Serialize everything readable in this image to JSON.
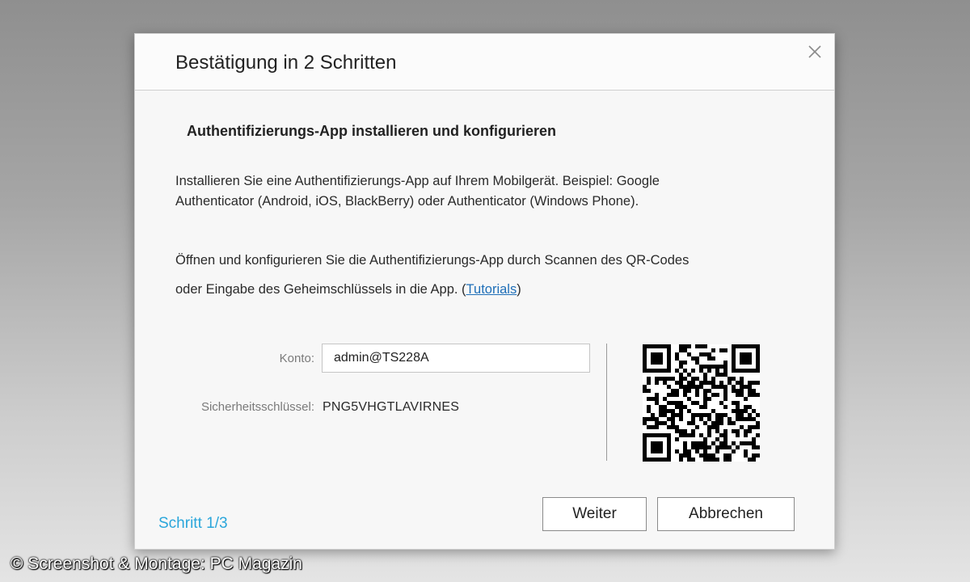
{
  "dialog": {
    "title": "Bestätigung in 2 Schritten",
    "close_icon": "close-icon",
    "section_title": "Authentifizierungs-App installieren und konfigurieren",
    "paragraph1_line1": "Installieren Sie eine Authentifizierungs-App auf Ihrem Mobilgerät. Beispiel: Google",
    "paragraph1_line2": "Authenticator (Android, iOS, BlackBerry) oder Authenticator (Windows Phone).",
    "paragraph2_line1": "Öffnen und konfigurieren Sie die Authentifizierungs-App durch Scannen des QR-Codes",
    "paragraph2_line2_prefix": "oder Eingabe des Geheimschlüssels in die App. (",
    "tutorials_link": "Tutorials",
    "paragraph2_line2_suffix": ")",
    "account_label": "Konto:",
    "account_value": "admin@TS228A",
    "security_key_label": "Sicherheitsschlüssel:",
    "security_key_value": "PNG5VHGTLAVIRNES",
    "qr_icon": "qr-code-icon",
    "step_indicator": "Schritt 1/3",
    "next_button": "Weiter",
    "cancel_button": "Abbrechen"
  },
  "credit": "© Screenshot & Montage: PC Magazin",
  "colors": {
    "accent_step": "#2aa6db",
    "link": "#1f6fb8",
    "dialog_bg": "#f7f7f7"
  }
}
